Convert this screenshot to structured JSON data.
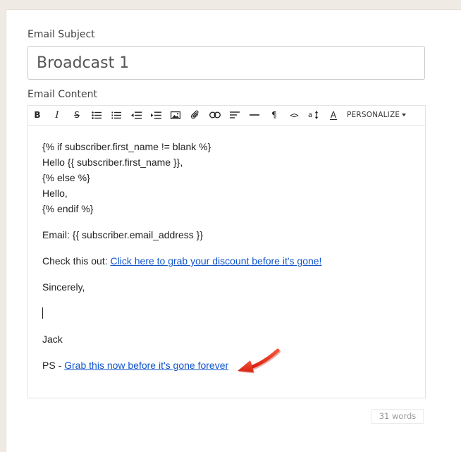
{
  "form": {
    "subject_label": "Email Subject",
    "subject_value": "Broadcast 1",
    "content_label": "Email Content"
  },
  "toolbar": {
    "buttons": [
      {
        "name": "bold-button",
        "icon": "bold-icon",
        "glyph": "B"
      },
      {
        "name": "italic-button",
        "icon": "italic-icon",
        "glyph": "I"
      },
      {
        "name": "strikethrough-button",
        "icon": "strikethrough-icon",
        "glyph": "S"
      },
      {
        "name": "bullet-list-button",
        "icon": "bullet-list-icon"
      },
      {
        "name": "numbered-list-button",
        "icon": "numbered-list-icon"
      },
      {
        "name": "outdent-button",
        "icon": "outdent-icon"
      },
      {
        "name": "indent-button",
        "icon": "indent-icon"
      },
      {
        "name": "image-button",
        "icon": "image-icon"
      },
      {
        "name": "attachment-button",
        "icon": "paperclip-icon"
      },
      {
        "name": "link-button",
        "icon": "link-icon"
      },
      {
        "name": "align-button",
        "icon": "align-left-icon"
      },
      {
        "name": "horizontal-rule-button",
        "icon": "horizontal-rule-icon"
      },
      {
        "name": "paragraph-button",
        "icon": "pilcrow-icon",
        "glyph": "¶"
      },
      {
        "name": "code-button",
        "icon": "code-icon",
        "glyph": "<>"
      },
      {
        "name": "font-size-button",
        "icon": "font-size-icon"
      },
      {
        "name": "text-color-button",
        "icon": "text-color-icon",
        "glyph": "A"
      }
    ],
    "personalize_label": "PERSONALIZE"
  },
  "content": {
    "line1": "{% if subscriber.first_name != blank %}",
    "line2": "Hello {{ subscriber.first_name }},",
    "line3": "{% else %}",
    "line4": "Hello,",
    "line5": "{% endif %}",
    "email_line": "Email: {{ subscriber.email_address }}",
    "check_prefix": "Check this out: ",
    "check_link": "Click here to grab your discount before it's gone!",
    "sincerely": "Sincerely,",
    "signature": "Jack",
    "ps_prefix": "PS - ",
    "ps_link": "Grab this now before it's gone forever"
  },
  "footer": {
    "word_count": "31 words"
  },
  "colors": {
    "link": "#1155cc",
    "annotation_arrow": "#e8301c",
    "page_background": "#efebe4"
  }
}
